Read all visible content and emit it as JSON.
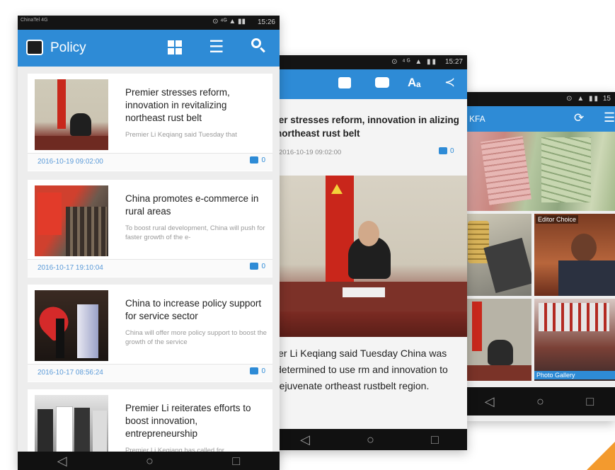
{
  "phone1": {
    "status": {
      "carrier": "ChinaTel 4G",
      "time": "15:26",
      "icons": "⊙ ⁴ᴳ ▲ ▮▮"
    },
    "appbar": {
      "title": "Policy"
    },
    "articles": [
      {
        "title": "Premier stresses reform, innovation in revitalizing northeast rust belt",
        "snippet": "Premier Li Keqiang said Tuesday that",
        "date": "2016-10-19 09:02:00",
        "likes": "0"
      },
      {
        "title": "China promotes e-commerce in rural areas",
        "snippet": "To boost rural development, China will push for faster growth of the e-",
        "date": "2016-10-17 19:10:04",
        "likes": "0"
      },
      {
        "title": "China to increase policy support for service sector",
        "snippet": "China will offer more policy support to boost the growth of the service",
        "date": "2016-10-17 08:56:24",
        "likes": "0"
      },
      {
        "title": "Premier Li reiterates efforts to boost innovation, entrepreneurship",
        "snippet": "Premier Li Keqiang has called for"
      }
    ],
    "nav": [
      "◁",
      "○",
      "□"
    ]
  },
  "phone2": {
    "status": {
      "time": "15:27"
    },
    "headline": "ier stresses reform, innovation in alizing northeast rust belt",
    "date": "2016-10-19 09:02:00",
    "likes": "0",
    "body": "ier Li Keqiang said Tuesday China was determined to use rm and innovation to rejuvenate ortheast rustbelt region.",
    "nav": [
      "◁",
      "○",
      "□"
    ]
  },
  "phone3": {
    "status": {
      "time": "15"
    },
    "appbar": {
      "title": "KFA"
    },
    "tiles": {
      "editor": "Editor Choice",
      "gallery": "Photo Gallery"
    },
    "nav": [
      "◁",
      "○",
      "□"
    ]
  }
}
